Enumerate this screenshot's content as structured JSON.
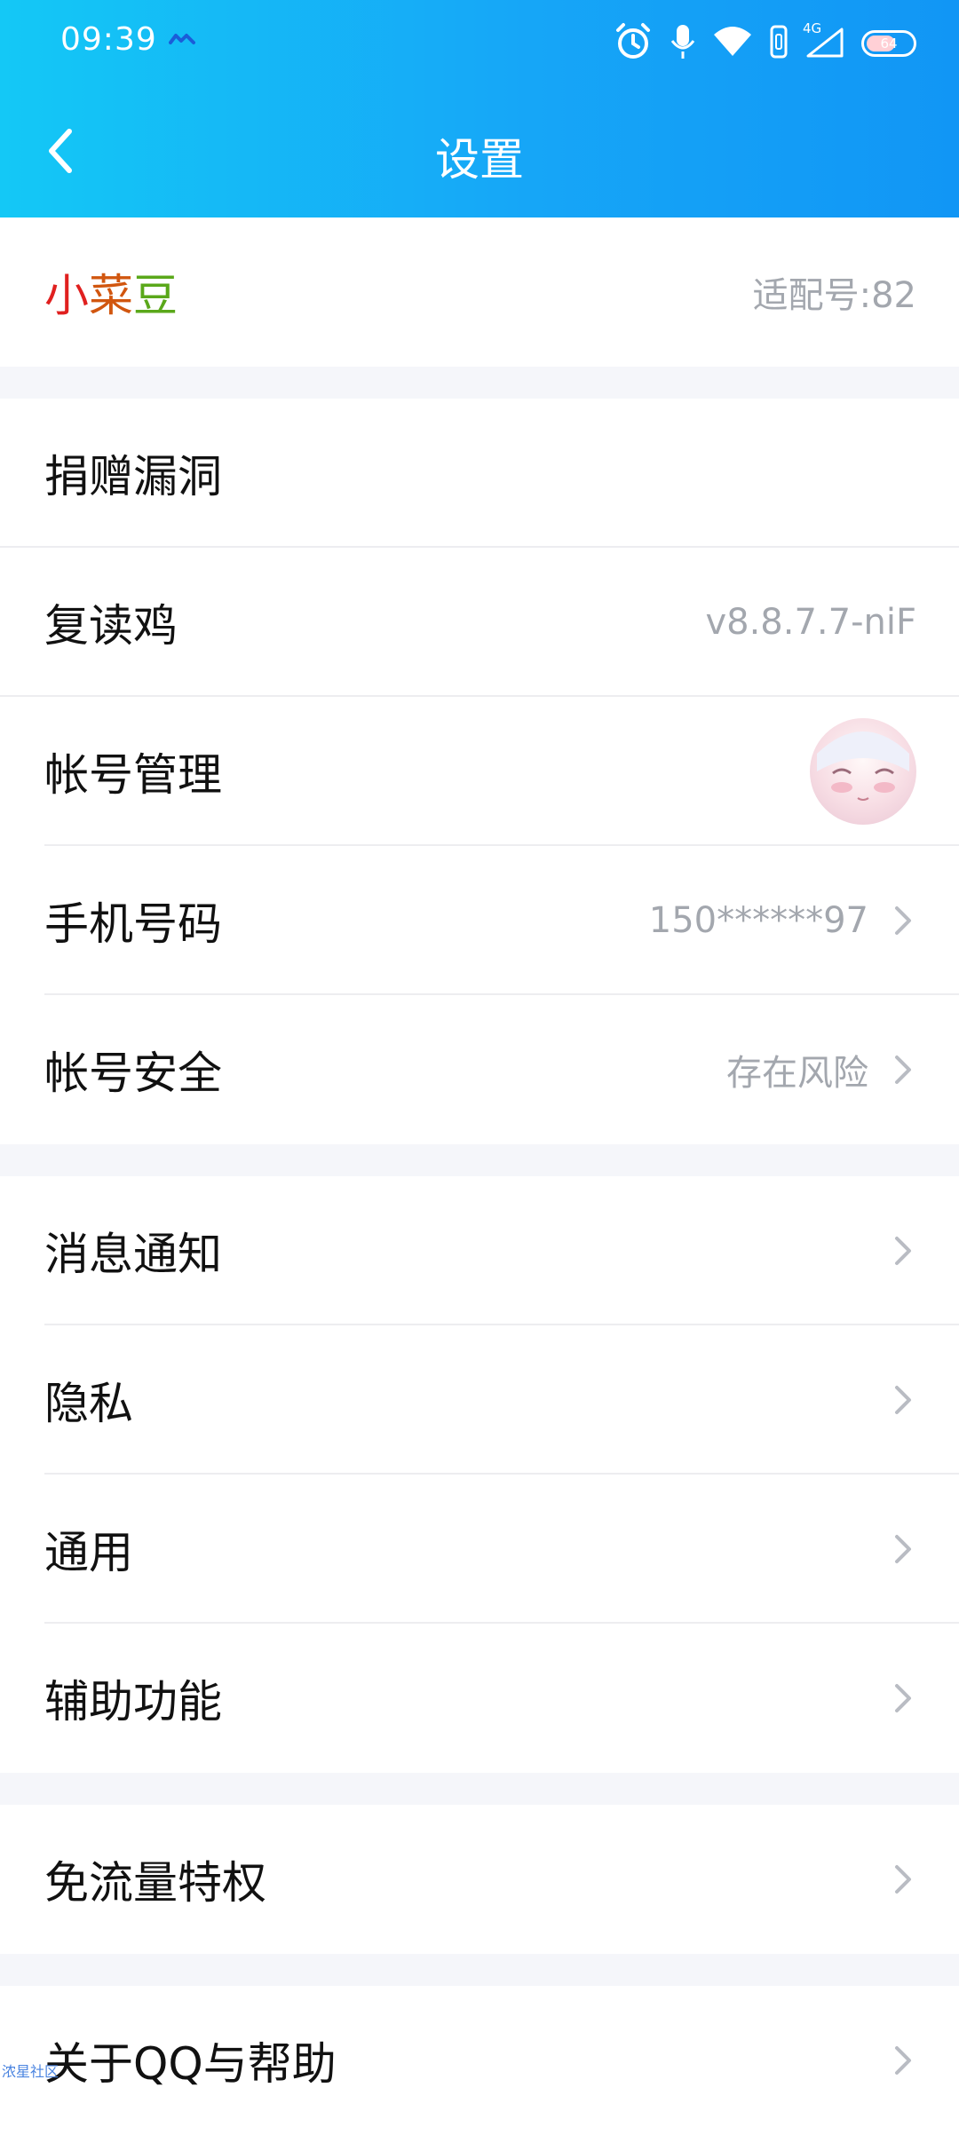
{
  "status_bar": {
    "time": "09:39",
    "network": "4G",
    "battery": "64",
    "icons": [
      "app-badge-icon",
      "alarm-icon",
      "microphone-icon",
      "wifi-icon",
      "vibrate-icon",
      "cellular-signal-icon",
      "battery-icon"
    ]
  },
  "nav": {
    "title": "设置",
    "back_icon": "chevron-left-icon"
  },
  "profile": {
    "name_parts": [
      "小",
      "菜",
      "豆"
    ],
    "name_colors": [
      "#e0201f",
      "#d1560f",
      "#5aa81a"
    ],
    "adapter": "适配号:82"
  },
  "group1": {
    "donate": "捐赠漏洞",
    "repeater": "复读鸡",
    "repeater_version": "v8.8.7.7-niF",
    "account_manage": "帐号管理",
    "phone_label": "手机号码",
    "phone_value": "150******97",
    "security_label": "帐号安全",
    "security_value": "存在风险"
  },
  "group2": {
    "notifications": "消息通知",
    "privacy": "隐私",
    "general": "通用",
    "accessibility": "辅助功能"
  },
  "group3": {
    "free_data": "免流量特权"
  },
  "group4": {
    "about": "关于QQ与帮助"
  },
  "watermark": "浓星社区",
  "colors": {
    "header_start": "#14c8f6",
    "header_end": "#1196f5",
    "page_bg": "#f5f6fa",
    "secondary_text": "#a3a7ae"
  }
}
